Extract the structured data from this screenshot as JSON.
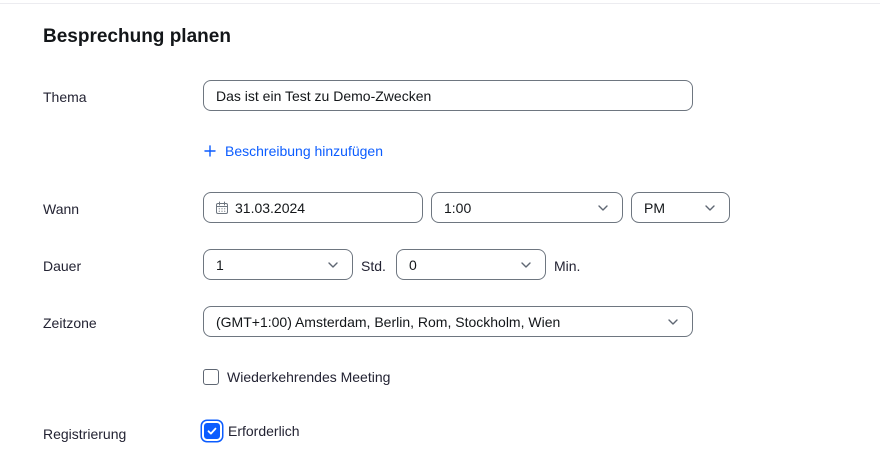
{
  "form": {
    "title": "Besprechung planen",
    "topic": {
      "label": "Thema",
      "value": "Das ist ein Test zu Demo-Zwecken",
      "add_description": "Beschreibung hinzufügen"
    },
    "when": {
      "label": "Wann",
      "date": "31.03.2024",
      "time": "1:00",
      "ampm": "PM"
    },
    "duration": {
      "label": "Dauer",
      "hours": "1",
      "hours_unit": "Std.",
      "minutes": "0",
      "minutes_unit": "Min."
    },
    "timezone": {
      "label": "Zeitzone",
      "value": "(GMT+1:00) Amsterdam, Berlin, Rom, Stockholm, Wien"
    },
    "recurring": {
      "label": "Wiederkehrendes Meeting",
      "checked": false
    },
    "registration": {
      "label": "Registrierung",
      "option_label": "Erforderlich",
      "checked": true
    }
  },
  "colors": {
    "accent": "#0b5cff",
    "border": "#6e7680",
    "text": "#232333"
  },
  "icons": {
    "calendar": "calendar-icon",
    "dropdown": "chevron-down-icon",
    "add": "plus-icon",
    "check": "checkmark-icon"
  }
}
